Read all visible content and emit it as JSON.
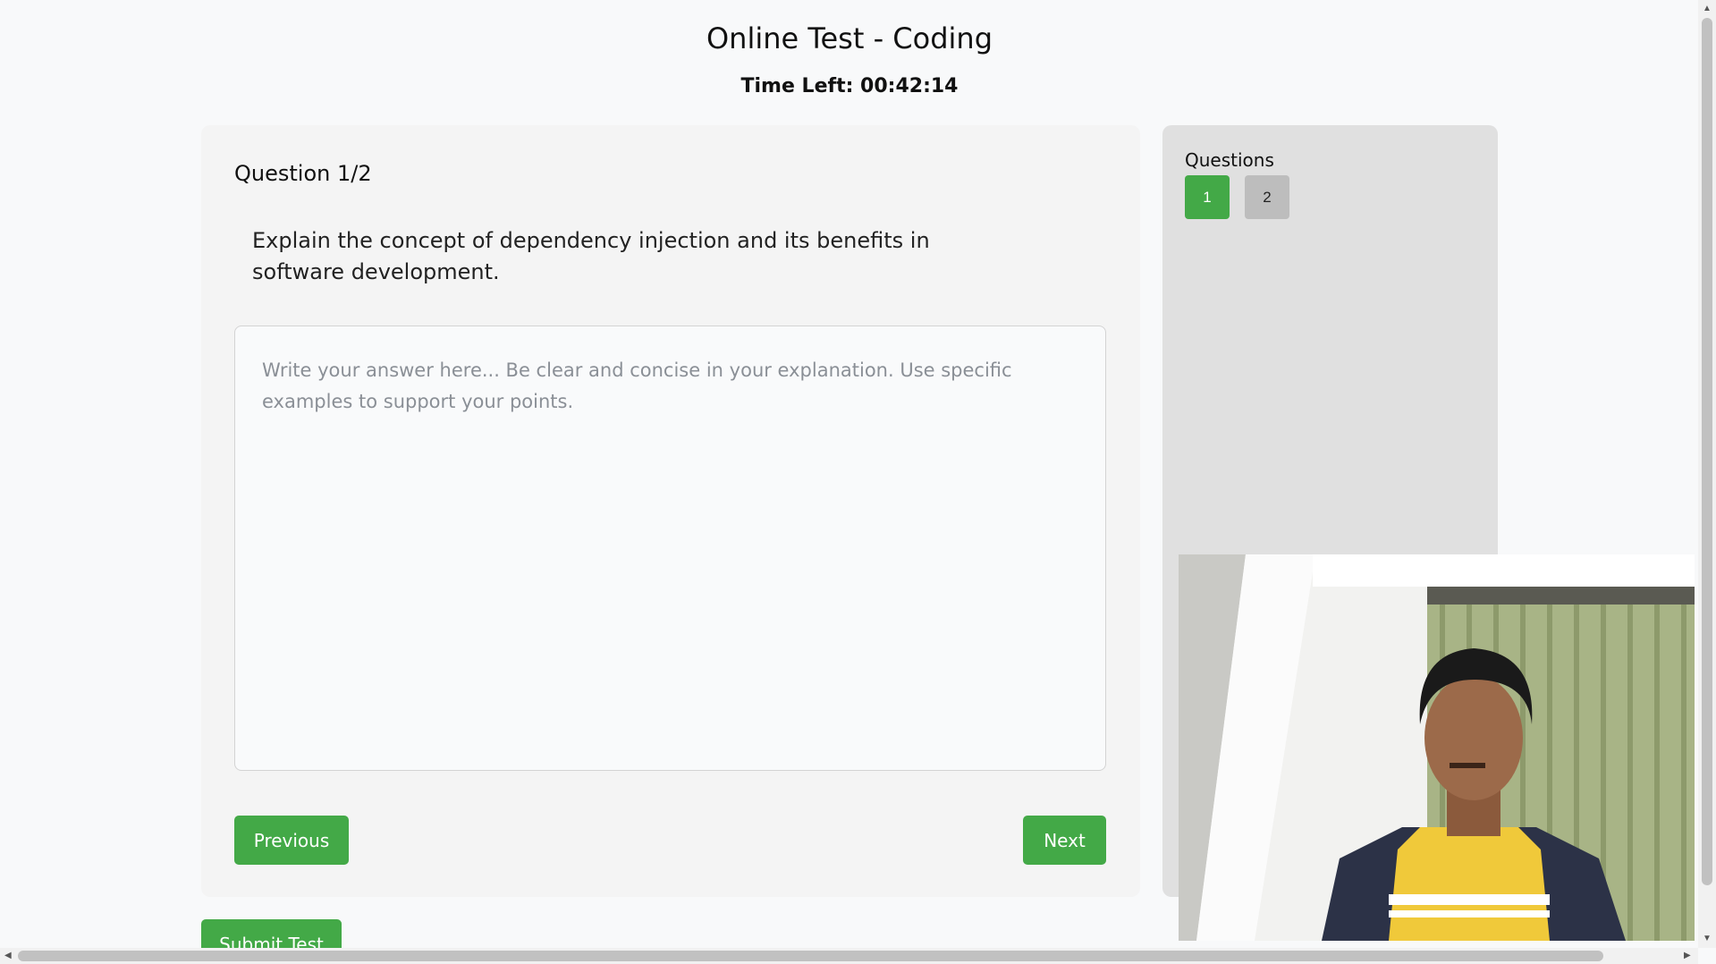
{
  "header": {
    "title": "Online Test - Coding",
    "timer": "Time Left: 00:42:14"
  },
  "question": {
    "number_label": "Question 1/2",
    "text": "Explain the concept of dependency injection and its benefits in software development.",
    "answer_value": "",
    "answer_placeholder": "Write your answer here... Be clear and concise in your explanation. Use specific examples to support your points."
  },
  "navigation": {
    "previous_label": "Previous",
    "next_label": "Next",
    "submit_label": "Submit Test"
  },
  "sidebar": {
    "title": "Questions",
    "items": [
      {
        "label": "1",
        "state": "active"
      },
      {
        "label": "2",
        "state": "idle"
      }
    ]
  },
  "colors": {
    "accent_green": "#43a947",
    "panel_bg": "#f4f4f4",
    "sidebar_bg": "#e0e0e0"
  }
}
